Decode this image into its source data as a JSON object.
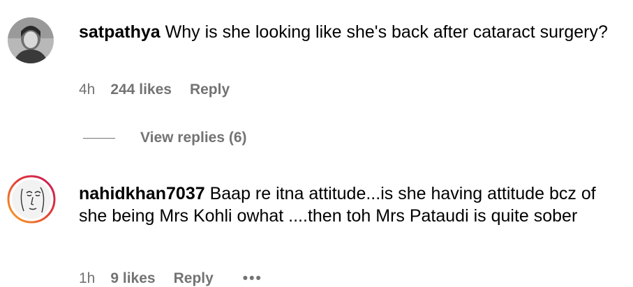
{
  "comments": [
    {
      "username": "satpathya",
      "text": "Why is she looking like she's back after cataract surgery?",
      "time": "4h",
      "likes": "244 likes",
      "reply_label": "Reply",
      "avatar_icon": "profile-photo-woman",
      "view_replies": "View replies (6)"
    },
    {
      "username": "nahidkhan7037",
      "text": "Baap re itna attitude...is she having attitude bcz of she being Mrs Kohli owhat ....then toh Mrs Pataudi is quite sober",
      "time": "1h",
      "likes": "9 likes",
      "reply_label": "Reply",
      "more_label": "•••",
      "avatar_icon": "profile-sketch-face-story-ring"
    }
  ],
  "colors": {
    "text": "#000000",
    "meta": "#737373",
    "story_ring_start": "#f9a825",
    "story_ring_end": "#c2185b"
  }
}
